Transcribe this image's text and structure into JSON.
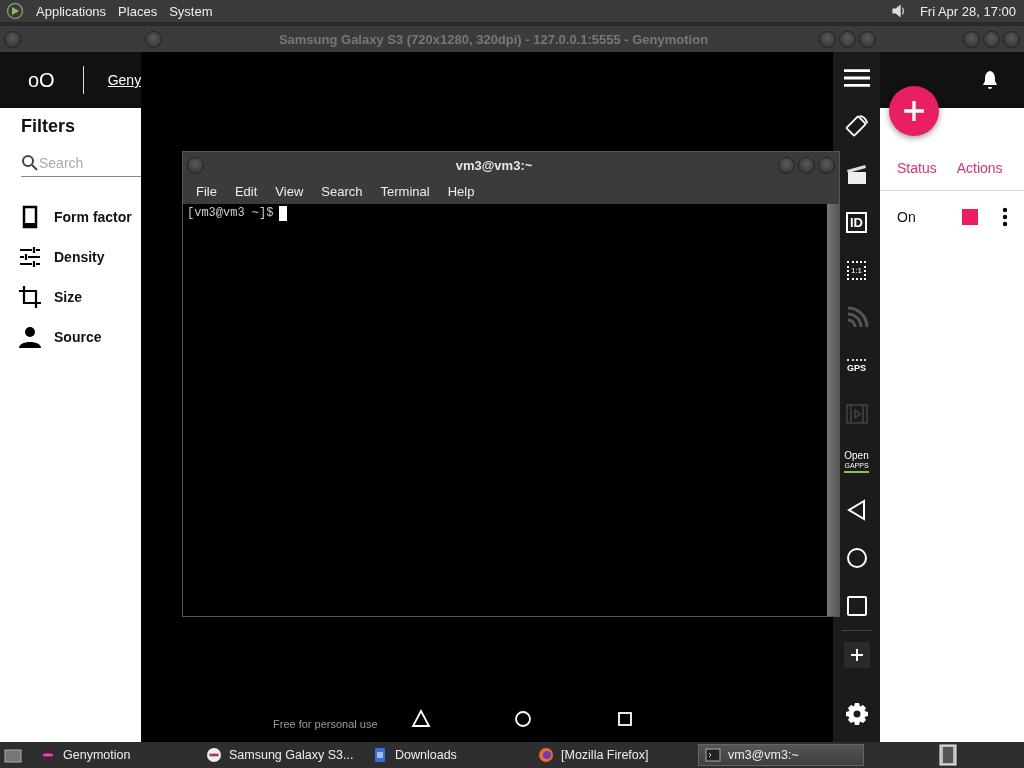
{
  "top_panel": {
    "menus": [
      "Applications",
      "Places",
      "System"
    ],
    "clock": "Fri Apr 28, 17:00"
  },
  "genymotion_window": {
    "header": {
      "logo": "oO",
      "title": "Geny"
    },
    "filters": {
      "title": "Filters",
      "search": {
        "placeholder": "Search"
      },
      "items": [
        {
          "kind": "form",
          "label": "Form factor"
        },
        {
          "kind": "density",
          "label": "Density"
        },
        {
          "kind": "size",
          "label": "Size"
        },
        {
          "kind": "source",
          "label": "Source"
        }
      ]
    },
    "table": {
      "columns": [
        "Status",
        "Actions"
      ],
      "rows": [
        {
          "status": "On",
          "color": "#e91e63"
        }
      ]
    }
  },
  "emulator_window": {
    "title": "Samsung Galaxy S3 (720x1280, 320dpi) - 127.0.0.1:5555 - Genymotion",
    "notice": "Free for personal use",
    "toolbar": [
      {
        "kind": "menu"
      },
      {
        "kind": "rotate"
      },
      {
        "kind": "camera"
      },
      {
        "kind": "id",
        "label": "ID"
      },
      {
        "kind": "pixel",
        "label": "1:1"
      },
      {
        "kind": "cast"
      },
      {
        "kind": "gps",
        "label": "GPS"
      },
      {
        "kind": "video"
      },
      {
        "kind": "gapps",
        "label": "Open",
        "sublabel": "GAPPS"
      },
      {
        "kind": "back"
      },
      {
        "kind": "home"
      },
      {
        "kind": "recent"
      },
      {
        "kind": "add"
      },
      {
        "kind": "settings"
      }
    ]
  },
  "terminal_window": {
    "title": "vm3@vm3:~",
    "menus": [
      "File",
      "Edit",
      "View",
      "Search",
      "Terminal",
      "Help"
    ],
    "prompt": "[vm3@vm3 ~]$"
  },
  "taskbar": {
    "items": [
      {
        "kind": "geny",
        "label": "Genymotion",
        "selected": false
      },
      {
        "kind": "phone",
        "label": "Samsung Galaxy S3...",
        "selected": false
      },
      {
        "kind": "folder",
        "label": "Downloads",
        "selected": false
      },
      {
        "kind": "browser",
        "label": "[Mozilla Firefox]",
        "selected": false
      },
      {
        "kind": "terminal",
        "label": "vm3@vm3:~",
        "selected": true
      }
    ]
  }
}
